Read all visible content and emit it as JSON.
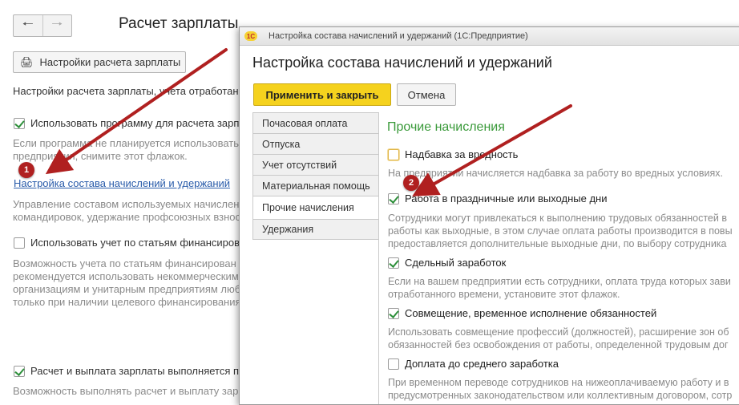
{
  "background": {
    "nav": {
      "back_icon": "arrow-left-icon",
      "forward_icon": "arrow-right-icon"
    },
    "title": "Расчет зарплаты",
    "settings_button": "Настройки расчета зарплаты",
    "settings_intro": "Настройки расчета зарплаты, учета отработанн",
    "use_program": {
      "label": "Использовать программу для расчета зарпл",
      "checked": true
    },
    "use_program_desc": [
      "Если программа не планируется использовать тол",
      "предприятия, снимите этот флажок."
    ],
    "link": "Настройка состава начислений и удержаний",
    "link_desc": [
      "Управление составом используемых начислен",
      "командировок, удержание профсоюзных взнос"
    ],
    "financing": {
      "label": "Использовать учет по статьям финансирова",
      "checked": false
    },
    "financing_desc": [
      "Возможность учета по статьям финансирован",
      "рекомендуется использовать некоммерческим",
      "организациям и унитарным предприятиям люб",
      "только при наличии целевого финансирования."
    ],
    "payment": {
      "label": "Расчет и выплата зарплаты выполняется по",
      "checked": true
    },
    "payment_desc": "Возможность выполнять расчет и выплату зарплат"
  },
  "dialog": {
    "window_title": "Настройка состава начислений и удержаний  (1С:Предприятие)",
    "logo_text": "1С",
    "heading": "Настройка состава начислений и удержаний",
    "apply_button": "Применить и закрыть",
    "cancel_button": "Отмена",
    "tabs": [
      {
        "label": "Почасовая оплата",
        "active": false
      },
      {
        "label": "Отпуска",
        "active": false
      },
      {
        "label": "Учет отсутствий",
        "active": false
      },
      {
        "label": "Материальная помощь",
        "active": false
      },
      {
        "label": "Прочие начисления",
        "active": true
      },
      {
        "label": "Удержания",
        "active": false
      }
    ],
    "section_title": "Прочие начисления",
    "options": [
      {
        "label": "Надбавка за вредность",
        "checked": false,
        "desc": [
          "На предприятии начисляется надбавка за работу во вредных условиях."
        ]
      },
      {
        "label": "Работа в праздничные или выходные дни",
        "checked": true,
        "desc": [
          "Сотрудники могут привлекаться к выполнению трудовых обязанностей в",
          "работы как выходные, в этом случае оплата работы производится в повы",
          "предоставляется дополнительные выходные дни, по выбору сотрудника"
        ]
      },
      {
        "label": "Сдельный заработок",
        "checked": true,
        "desc": [
          "Если на вашем предприятии есть сотрудники, оплата труда которых зави",
          "отработанного времени, установите этот флажок."
        ]
      },
      {
        "label": "Совмещение, временное исполнение обязанностей",
        "checked": true,
        "desc": [
          "Использовать совмещение профессий (должностей), расширение зон об",
          "обязанностей без освобождения от работы, определенной трудовым дог"
        ]
      },
      {
        "label": "Доплата до среднего заработка",
        "checked": false,
        "desc": [
          "При временном переводе сотрудников на нижеоплачиваемую работу и в",
          "предусмотренных законодательством или коллективным договором, сотр"
        ]
      }
    ]
  },
  "markers": [
    "1",
    "2"
  ],
  "colors": {
    "accent_yellow": "#f5d21e",
    "section_green": "#3a9a3a",
    "link_blue": "#2a5caa",
    "arrow_red": "#b02020"
  }
}
